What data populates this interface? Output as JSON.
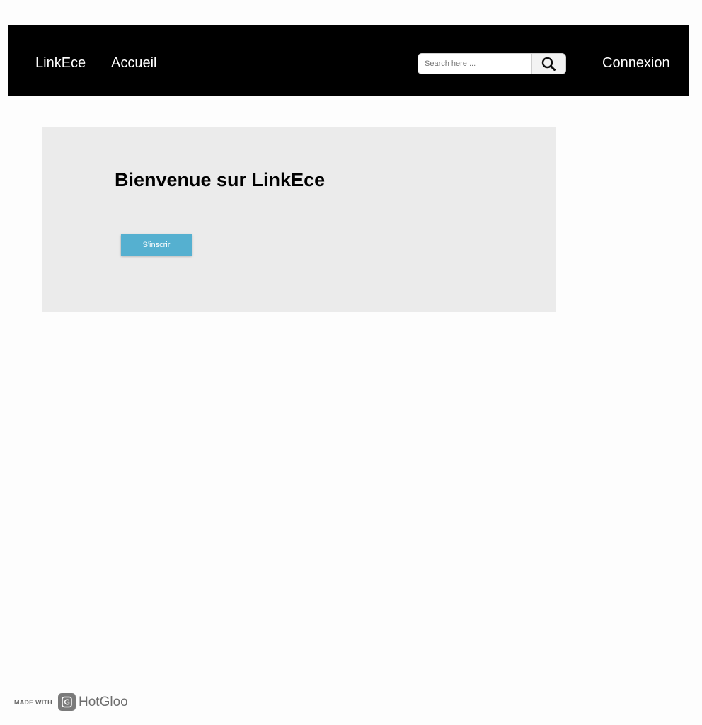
{
  "header": {
    "brand": "LinkEce",
    "home_link": "Accueil",
    "search": {
      "placeholder": "Search here ..."
    },
    "login_link": "Connexion"
  },
  "hero": {
    "title": "Bienvenue sur LinkEce",
    "signup_button": "S'inscrir"
  },
  "footer_badge": {
    "prefix": "MADE WITH",
    "brand": "HotGloo"
  },
  "colors": {
    "navbar_background": "#000000",
    "nav_text": "#ffffff",
    "hero_background": "#ebebeb",
    "signup_button": "#55b0d0",
    "page_background": "#fdfdfd"
  },
  "icons": {
    "search_button": "search-icon",
    "badge_logo": "hotgloo-logo-icon"
  }
}
